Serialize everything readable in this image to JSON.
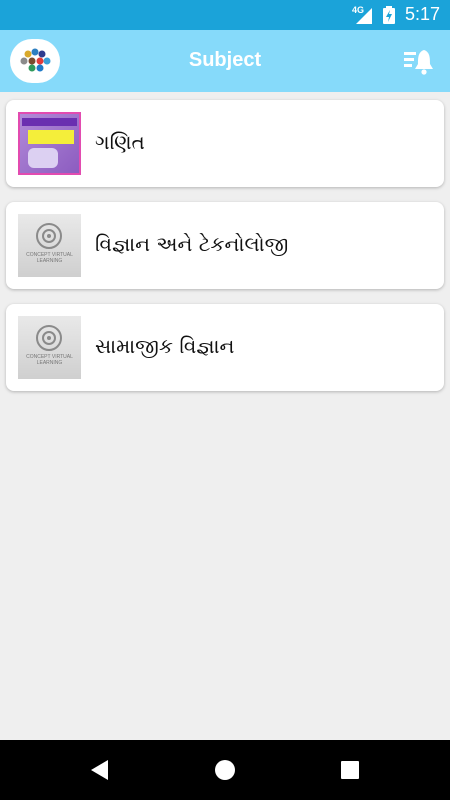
{
  "status_bar": {
    "network": "4G",
    "time": "5:17"
  },
  "app_bar": {
    "title": "Subject",
    "logo_icon": "dots-logo-icon",
    "notification_icon": "notification-list-icon"
  },
  "subjects": [
    {
      "label": "ગણિત",
      "thumbnail": "book-cover"
    },
    {
      "label": "વિજ્ઞાન અને ટેકનોલોજી",
      "thumbnail": "placeholder-logo",
      "thumb_text": "CONCEPT VIRTUAL LEARNING"
    },
    {
      "label": "સામાજીક વિજ્ઞાન",
      "thumbnail": "placeholder-logo",
      "thumb_text": "CONCEPT VIRTUAL LEARNING"
    }
  ],
  "nav_bar": {
    "back_icon": "back-triangle-icon",
    "home_icon": "home-circle-icon",
    "recents_icon": "recents-square-icon"
  },
  "colors": {
    "status_bar": "#1ba3d9",
    "app_bar": "#86dafa",
    "background": "#efefef"
  }
}
